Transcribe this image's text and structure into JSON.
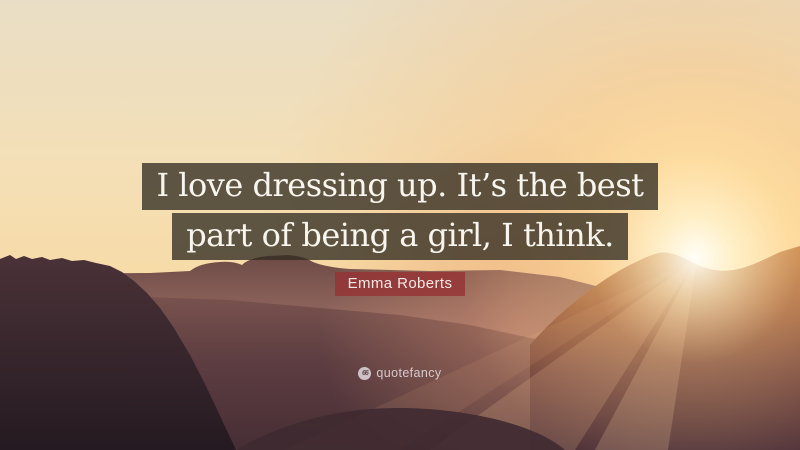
{
  "quote": {
    "line1": "I love dressing up. It’s the best",
    "line2": "part of being a girl, I think.",
    "text_color": "#f8f5ee",
    "box_color": "rgba(50,45,35,0.78)"
  },
  "attribution": {
    "name": "Emma Roberts",
    "box_color": "rgba(150,50,52,0.80)",
    "text_color": "#f5e9e6"
  },
  "watermark": {
    "brand": "quotefancy",
    "icon": "quote-marks-icon",
    "icon_glyph": "66",
    "color": "rgba(242,236,240,0.78)"
  },
  "background_palette": {
    "sky_top": "#e9dec5",
    "sky_mid": "#f7dba7",
    "horizon": "#f0c9a0",
    "sun_glow": "#fff3d2",
    "mountain_sunlit": "#c07940",
    "mountain_shadow": "#4d3039",
    "distant_ridge": "#6d4a45",
    "foreground_cliff": "#251a21"
  },
  "css_vars": {
    "--quote-box-bg": "rgba(50,45,35,0.78)",
    "--quote-text": "#f8f5ee",
    "--attr-box-bg": "rgba(150,50,52,0.80)",
    "--attr-text": "#f5e9e6",
    "--watermark-color": "rgba(242,236,240,0.78)"
  }
}
